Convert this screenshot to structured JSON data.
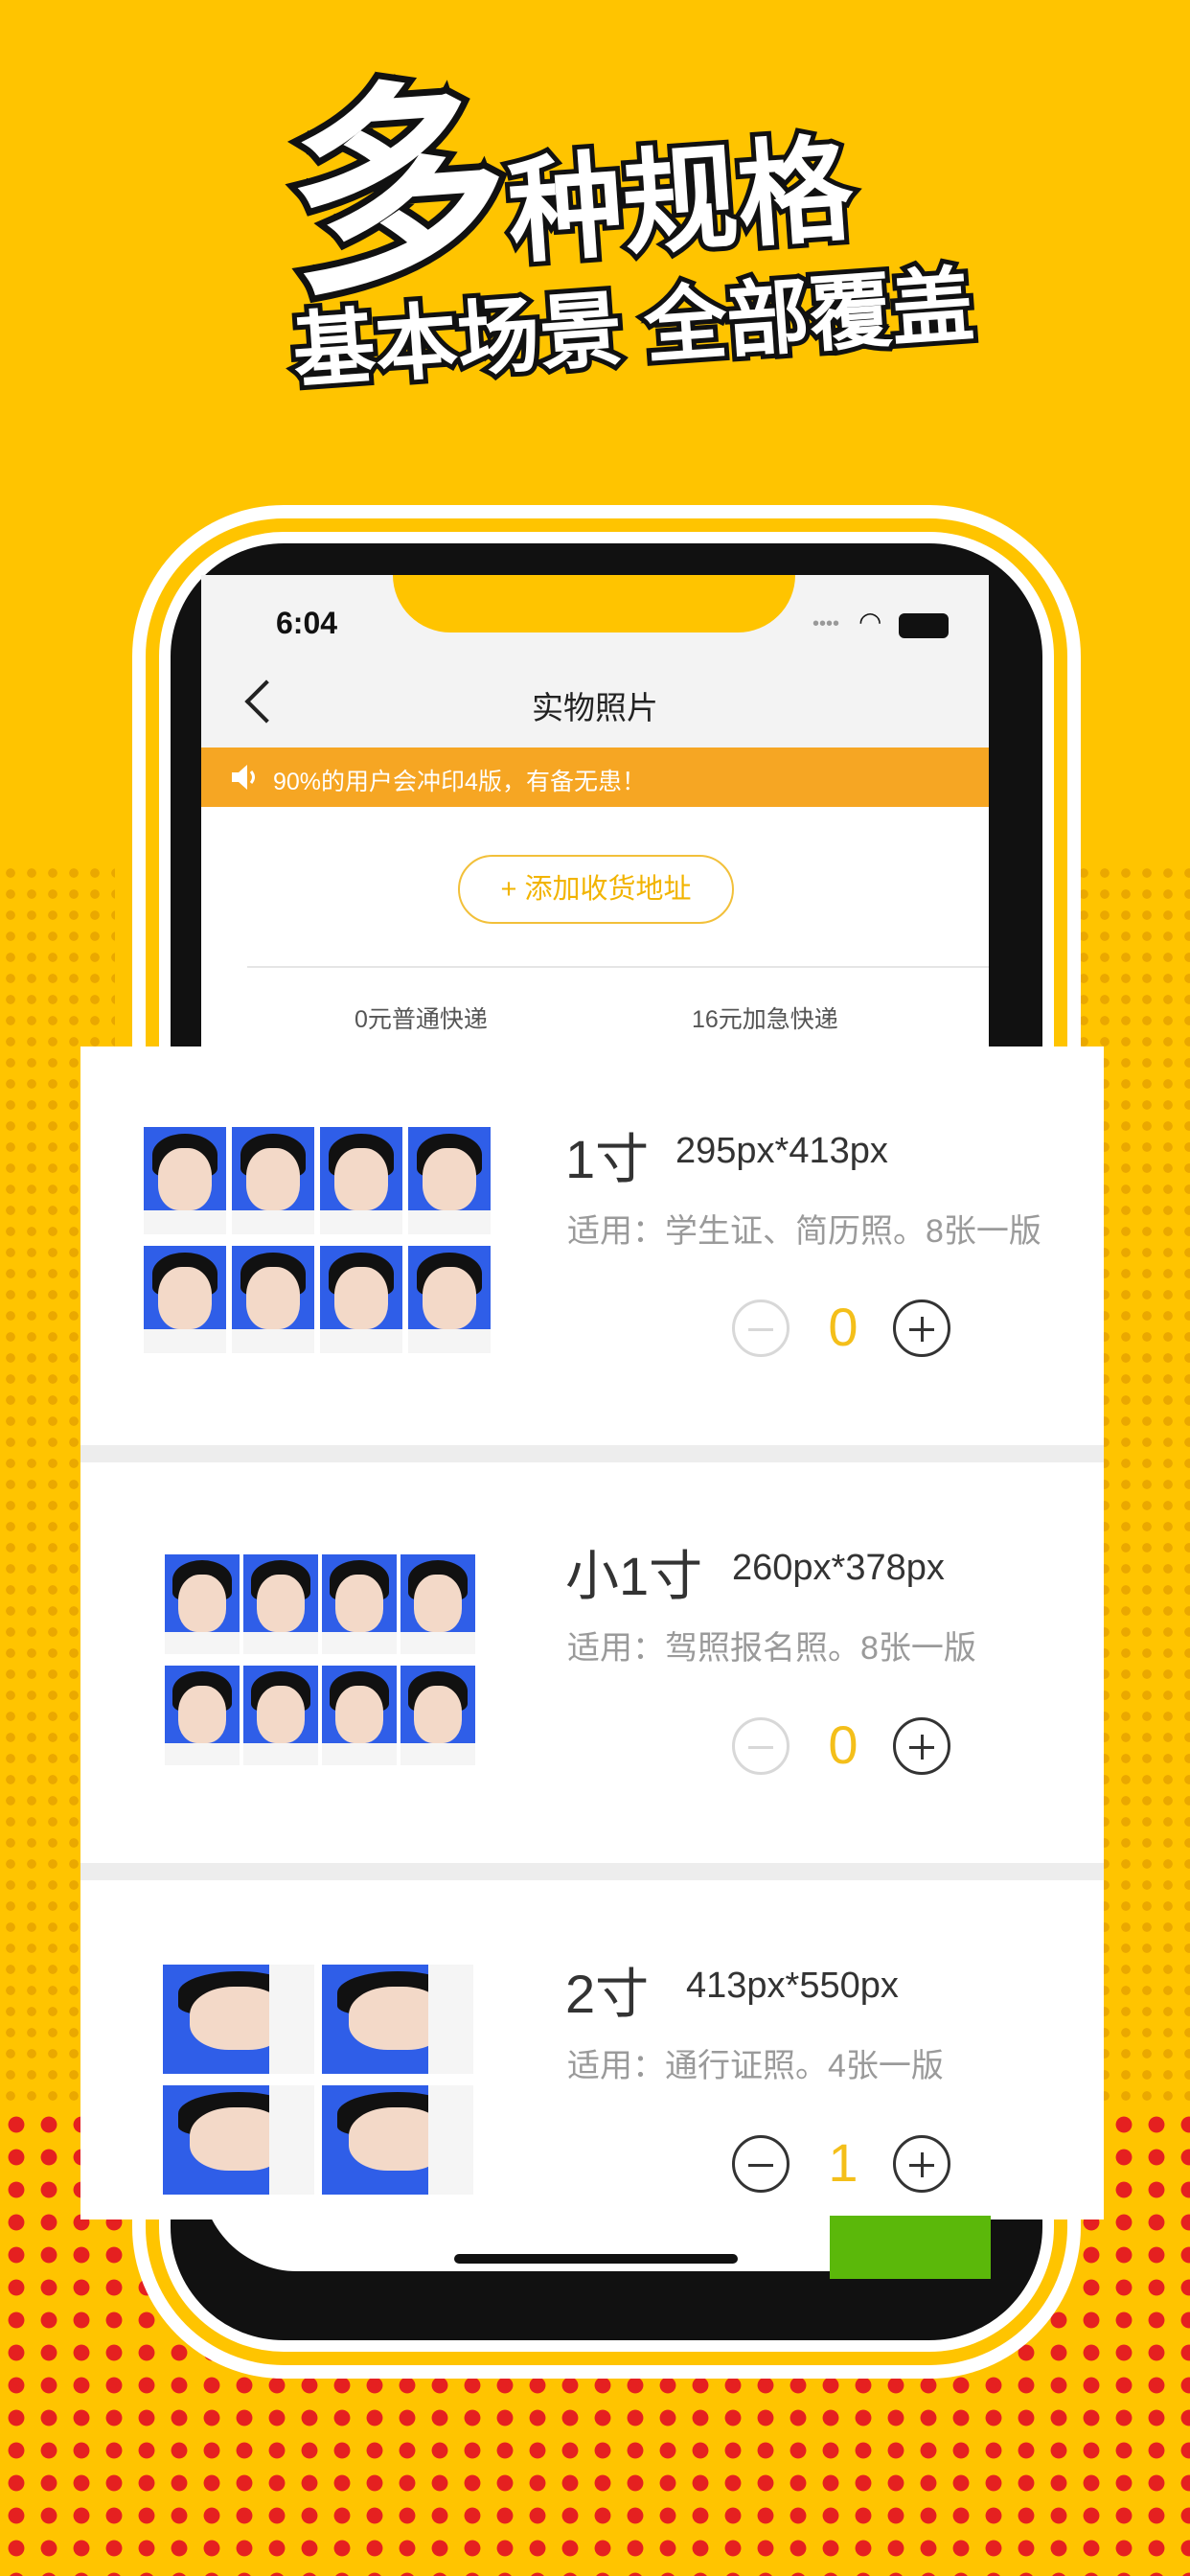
{
  "headline": {
    "big": "多",
    "line1": "种规格",
    "line2": "基本场景 全部覆盖"
  },
  "status_bar": {
    "time": "6:04"
  },
  "nav": {
    "title": "实物照片"
  },
  "notice": {
    "text": "90%的用户会冲印4版，有备无患！"
  },
  "address": {
    "button_label": "+ 添加收货地址"
  },
  "shipping": {
    "standard": "0元普通快递",
    "express": "16元加急快递"
  },
  "products": [
    {
      "size": "1寸",
      "dimensions": "295px*413px",
      "usage": "适用：学生证、简历照。8张一版",
      "quantity": "0"
    },
    {
      "size": "小1寸",
      "dimensions": "260px*378px",
      "usage": "适用：驾照报名照。8张一版",
      "quantity": "0"
    },
    {
      "size": "2寸",
      "dimensions": "413px*550px",
      "usage": "适用：通行证照。4张一版",
      "quantity": "1"
    }
  ],
  "colors": {
    "background": "#FFC400",
    "accent": "#F4BF1A",
    "notice": "#F6A623",
    "photo_bg": "#2F5EE8"
  }
}
